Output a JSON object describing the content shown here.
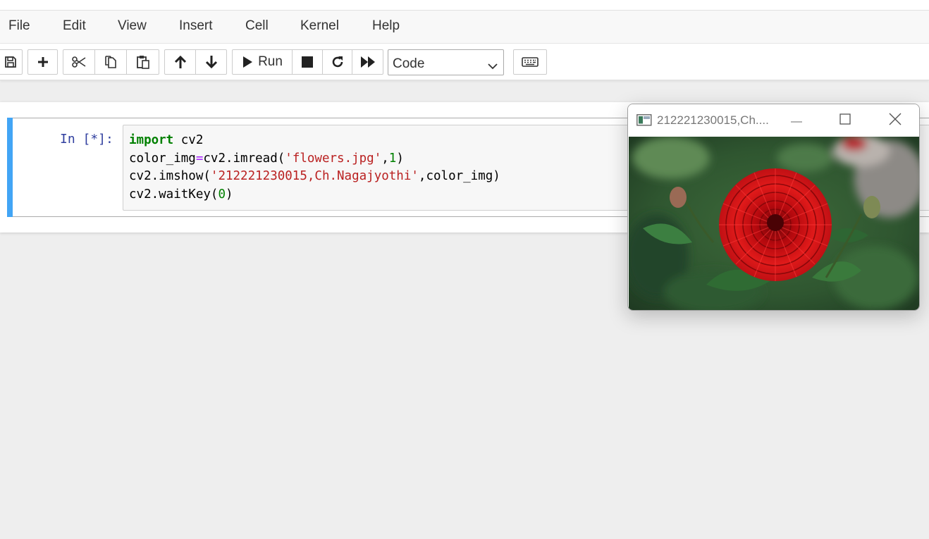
{
  "menubar": {
    "items": [
      "File",
      "Edit",
      "View",
      "Insert",
      "Cell",
      "Kernel",
      "Help"
    ]
  },
  "toolbar": {
    "run_label": "Run",
    "cell_type_value": "Code",
    "icons": [
      "save-icon",
      "plus-icon",
      "cut-icon",
      "copy-icon",
      "paste-icon",
      "arrow-up-icon",
      "arrow-down-icon",
      "play-icon",
      "stop-icon",
      "restart-icon",
      "fast-forward-icon",
      "keyboard-icon"
    ]
  },
  "cell": {
    "prompt": "In [*]:",
    "code": {
      "l1_kw": "import",
      "l1_rest": " cv2",
      "l2_a": "color_img",
      "l2_op": "=",
      "l2_b": "cv2.imread(",
      "l2_str": "'flowers.jpg'",
      "l2_c": ",",
      "l2_num": "1",
      "l2_d": ")",
      "l3_a": "cv2.imshow(",
      "l3_str": "'212221230015,Ch.Nagajyothi'",
      "l3_b": ",color_img)",
      "l4_a": "cv2.waitKey(",
      "l4_num": "0",
      "l4_b": ")"
    }
  },
  "image_window": {
    "title": "212221230015,Ch....",
    "image_subject": "red dahlia flower"
  },
  "colors": {
    "cell_selected_bar": "#42a5f5",
    "keyword": "#008000",
    "string": "#ba2121",
    "operator": "#aa22ff",
    "prompt": "#303f9f"
  }
}
